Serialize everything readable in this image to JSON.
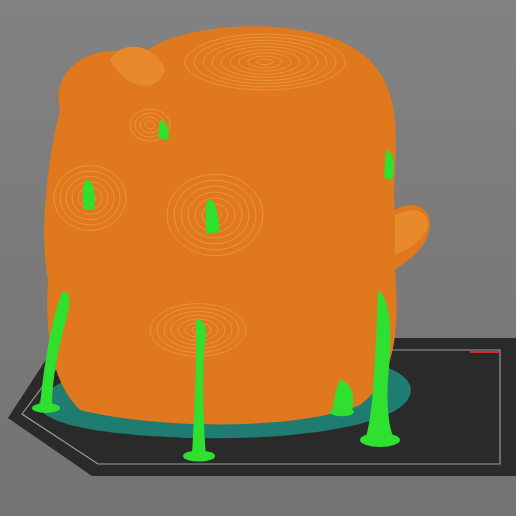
{
  "viewport": {
    "mode": "3d-preview"
  },
  "scene": [
    {
      "kind": "bed",
      "color": "#2a2a2a"
    },
    {
      "kind": "brim",
      "color": "#1f8a7c"
    },
    {
      "kind": "model",
      "color": "#e0781e"
    },
    {
      "kind": "support",
      "color": "#2fe02f"
    }
  ]
}
